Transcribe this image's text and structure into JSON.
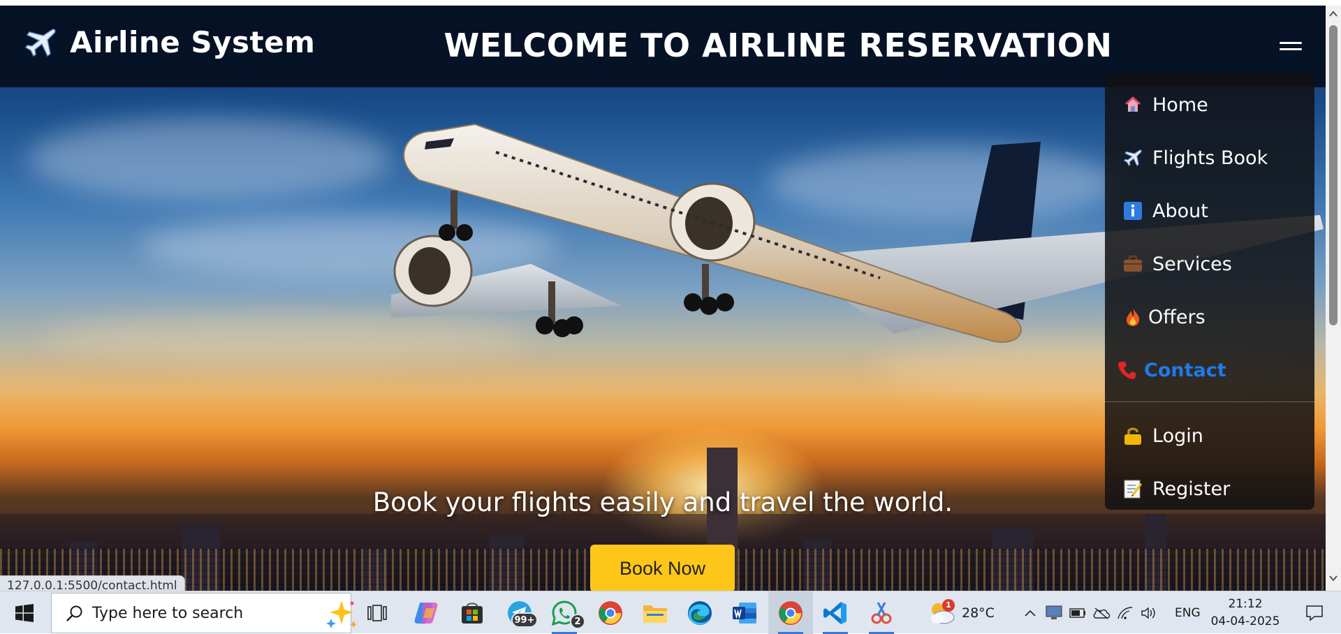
{
  "header": {
    "brand": "Airline System",
    "headline": "WELCOME TO AIRLINE RESERVATION",
    "menu_icon": "hamburger-icon"
  },
  "menu": {
    "items": [
      {
        "label": "Home",
        "icon": "home-icon"
      },
      {
        "label": "Flights Book",
        "icon": "airplane-icon"
      },
      {
        "label": "About",
        "icon": "info-icon"
      },
      {
        "label": "Services",
        "icon": "briefcase-icon"
      },
      {
        "label": "Offers",
        "icon": "fire-icon"
      },
      {
        "label": "Contact",
        "icon": "phone-icon",
        "active": true
      },
      {
        "label": "Login",
        "icon": "lock-icon"
      },
      {
        "label": "Register",
        "icon": "memo-icon"
      }
    ],
    "active_color": "#1f7ae8"
  },
  "hero": {
    "tagline": "Book your flights easily and travel the world.",
    "cta": "Book Now",
    "cta_color": "#ffc61a"
  },
  "browser": {
    "status_url": "127.0.0.1:5500/contact.html"
  },
  "taskbar": {
    "search_placeholder": "Type here to search",
    "apps": [
      {
        "name": "task-view",
        "icon": "task-view-icon"
      },
      {
        "name": "copilot",
        "icon": "copilot-icon"
      },
      {
        "name": "microsoft-store",
        "icon": "store-icon"
      },
      {
        "name": "telegram",
        "icon": "telegram-icon",
        "badge": "99+"
      },
      {
        "name": "whatsapp",
        "icon": "whatsapp-icon",
        "badge": "2"
      },
      {
        "name": "chrome",
        "icon": "chrome-icon"
      },
      {
        "name": "file-explorer",
        "icon": "folder-icon"
      },
      {
        "name": "edge",
        "icon": "edge-icon"
      },
      {
        "name": "word",
        "icon": "word-icon"
      },
      {
        "name": "chrome-active",
        "icon": "chrome-icon",
        "active": true
      },
      {
        "name": "vscode",
        "icon": "vscode-icon"
      },
      {
        "name": "snipping-tool",
        "icon": "snipping-icon"
      }
    ],
    "weather": {
      "temp": "28°C",
      "badge": "1"
    },
    "language": "ENG",
    "time": "21:12",
    "date": "04-04-2025"
  }
}
